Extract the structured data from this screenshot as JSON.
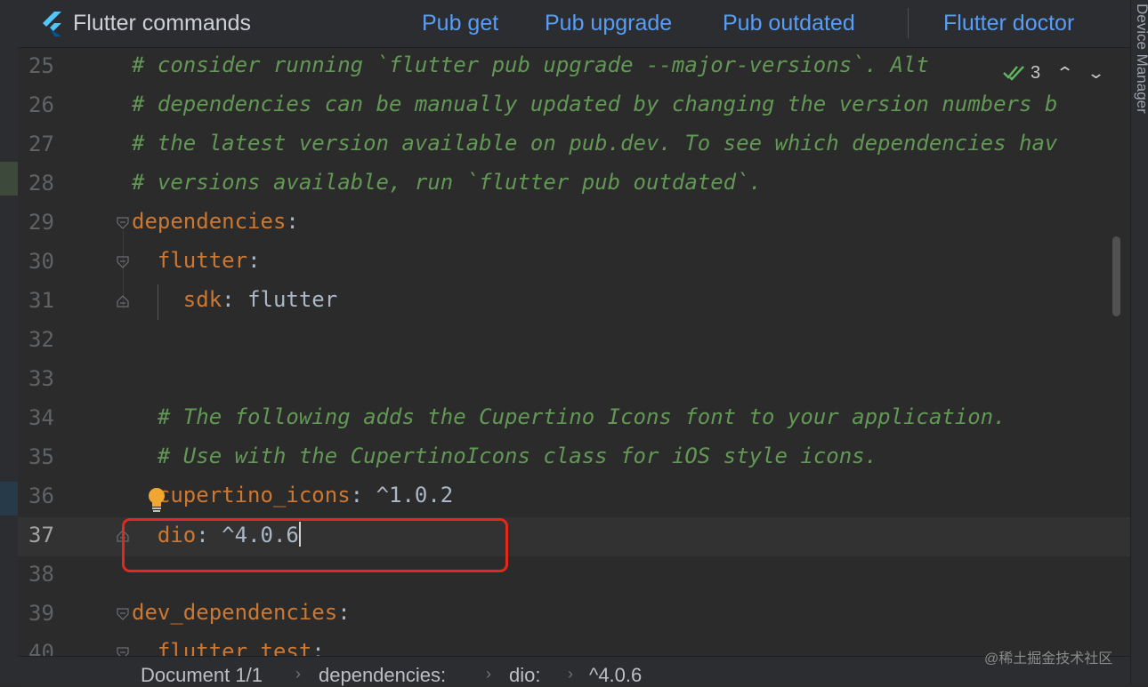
{
  "toolbar": {
    "title": "Flutter commands",
    "actions": [
      "Pub get",
      "Pub upgrade",
      "Pub outdated",
      "Flutter doctor"
    ]
  },
  "side_panel": {
    "right_label": "Device Manager"
  },
  "inspections": {
    "count": "3",
    "icon": "double-check-icon"
  },
  "editor": {
    "lines": [
      {
        "num": "25",
        "indent": "",
        "comment": "# consider running `flutter pub upgrade --major-versions`. Alt"
      },
      {
        "num": "26",
        "indent": "",
        "comment": "# dependencies can be manually updated by changing the version numbers b"
      },
      {
        "num": "27",
        "indent": "",
        "comment": "# the latest version available on pub.dev. To see which dependencies hav"
      },
      {
        "num": "28",
        "indent": "",
        "comment": "# versions available, run `flutter pub outdated`."
      },
      {
        "num": "29",
        "indent": "",
        "key": "dependencies",
        "punc": ":"
      },
      {
        "num": "30",
        "indent": "  ",
        "key": "flutter",
        "punc": ":"
      },
      {
        "num": "31",
        "indent": "    ",
        "key": "sdk",
        "punc": ": ",
        "value": "flutter"
      },
      {
        "num": "32",
        "indent": ""
      },
      {
        "num": "33",
        "indent": ""
      },
      {
        "num": "34",
        "indent": "  ",
        "comment": "# The following adds the Cupertino Icons font to your application."
      },
      {
        "num": "35",
        "indent": "  ",
        "comment": "# Use with the CupertinoIcons class for iOS style icons."
      },
      {
        "num": "36",
        "indent": "  ",
        "key": "cupertino_icons",
        "punc": ": ",
        "value": "^1.0.2"
      },
      {
        "num": "37",
        "indent": "  ",
        "key": "dio",
        "punc": ": ",
        "value": "^4.0.6",
        "current": true
      },
      {
        "num": "38",
        "indent": ""
      },
      {
        "num": "39",
        "indent": "",
        "key": "dev_dependencies",
        "punc": ":"
      },
      {
        "num": "40",
        "indent": "  ",
        "key": "flutter_test",
        "punc": ":"
      }
    ]
  },
  "breadcrumb": [
    "Document 1/1",
    "dependencies:",
    "dio:",
    "^4.0.6"
  ],
  "watermark": "@稀土掘金技术社区",
  "colors": {
    "comment": "#629755",
    "key": "#cc7832",
    "link": "#589df6",
    "highlight_box": "#e5281c",
    "bulb": "#f0a732"
  }
}
